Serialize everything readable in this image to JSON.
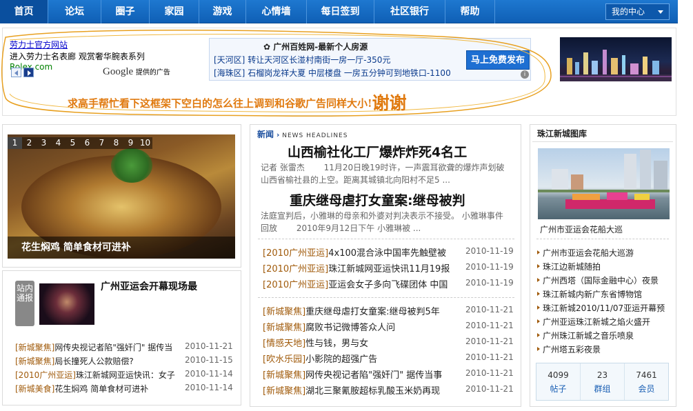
{
  "nav": {
    "items": [
      "首页",
      "论坛",
      "圈子",
      "家园",
      "游戏",
      "心情墙",
      "每日签到",
      "社区银行",
      "帮助"
    ],
    "user_center": "我的中心"
  },
  "google_ad": {
    "link_text": "劳力士官方网站",
    "line2": "进入劳力士名表廊 观赏奢华腕表系列",
    "url": "Rolex.com",
    "google_text": "Google",
    "ads_by": "提供的广告"
  },
  "realty_ad": {
    "title": "广州百姓网-最新个人房源",
    "rows": [
      {
        "tag": "[天河区]",
        "text": "转让天河区长湴村南街一房一厅-350元"
      },
      {
        "tag": "[海珠区]",
        "text": "石榴岗龙祥大夏 中层楼盘 一房五分钟可到地铁口-1100"
      }
    ],
    "button": "马上免费发布",
    "info": "i"
  },
  "plea": {
    "text": "求高手帮忙看下这框架下空白的怎么往上调到和谷歌广告同样大小!",
    "big": "谢谢"
  },
  "slideshow": {
    "numbers": [
      "1",
      "2",
      "3",
      "4",
      "5",
      "6",
      "7",
      "8",
      "9",
      "10"
    ],
    "active": 0,
    "caption": "花生焖鸡 简单食材可进补"
  },
  "notice": {
    "tab": "站内通报",
    "title": "广州亚运会开幕现场最",
    "list": [
      {
        "cat": "[新城聚焦]",
        "text": "网传央视记者陷\"强奸门\" 据传当",
        "date": "2010-11-21"
      },
      {
        "cat": "[新城聚焦]",
        "text": "局长撞死人公款赔偿?",
        "date": "2010-11-15"
      },
      {
        "cat": "[2010广州亚运]",
        "text": "珠江新城网亚运快讯：女子",
        "date": "2010-11-14"
      },
      {
        "cat": "[新城美食]",
        "text": "花生焖鸡 简单食材可进补",
        "date": "2010-11-14"
      }
    ]
  },
  "headlines": {
    "label_cn": "新闻",
    "label_en": "NEWS HEADLINES",
    "stories": [
      {
        "title": "山西榆社化工厂爆炸炸死4名工",
        "summary": "记者 张雷杰 　　11月20日晚19时许，一声震耳欲聋的爆炸声划破山西省榆社县的上空。距离其城镇北向阳村不足5 ..."
      },
      {
        "title": "重庆继母虐打女童案:继母被判",
        "summary": "法庭宣判后，小雅琳的母亲和外婆对判决表示不接受。 小雅琳事件回放 　　2010年9月12日下午 小雅琳被 ..."
      }
    ],
    "list_a": [
      {
        "cat": "[2010广州亚运]",
        "text": "4x100混合泳中国率先触壁被",
        "date": "2010-11-19"
      },
      {
        "cat": "[2010广州亚运]",
        "text": "珠江新城网亚运快讯11月19报",
        "date": "2010-11-19"
      },
      {
        "cat": "[2010广州亚运]",
        "text": "亚运会女子多向飞碟团体 中国",
        "date": "2010-11-19"
      }
    ],
    "list_b": [
      {
        "cat": "[新城聚焦]",
        "text": "重庆继母虐打女童案:继母被判5年",
        "date": "2010-11-21"
      },
      {
        "cat": "[新城聚焦]",
        "text": "腐败书记微博答众人问",
        "date": "2010-11-21"
      },
      {
        "cat": "[情感天地]",
        "text": "性与钱，男与女",
        "date": "2010-11-21"
      },
      {
        "cat": "[吹水乐园]",
        "text": "小影院的超强广告",
        "date": "2010-11-21"
      },
      {
        "cat": "[新城聚焦]",
        "text": "网传央视记者陷\"强奸门\" 据传当事",
        "date": "2010-11-21"
      },
      {
        "cat": "[新城聚焦]",
        "text": "湖北三聚氰胺超标乳酸玉米奶再现",
        "date": "2010-11-21"
      }
    ]
  },
  "gallery": {
    "title": "珠江新城图库",
    "caption": "广州市亚运会花船大巡",
    "items": [
      "广州市亚运会花船大巡游",
      "珠江边新城随拍",
      "广州西塔（国际金融中心）夜景",
      "珠江新城内新广东省博物馆",
      "珠江新城2010/11/07亚运开幕预",
      "广州亚运珠江新城之焰火盛开",
      "广州珠江新城之音乐喷泉",
      "广州塔五彩夜景"
    ],
    "stats": [
      {
        "value": "4099",
        "label": "帖子"
      },
      {
        "value": "23",
        "label": "群组"
      },
      {
        "value": "7461",
        "label": "会员"
      }
    ]
  }
}
